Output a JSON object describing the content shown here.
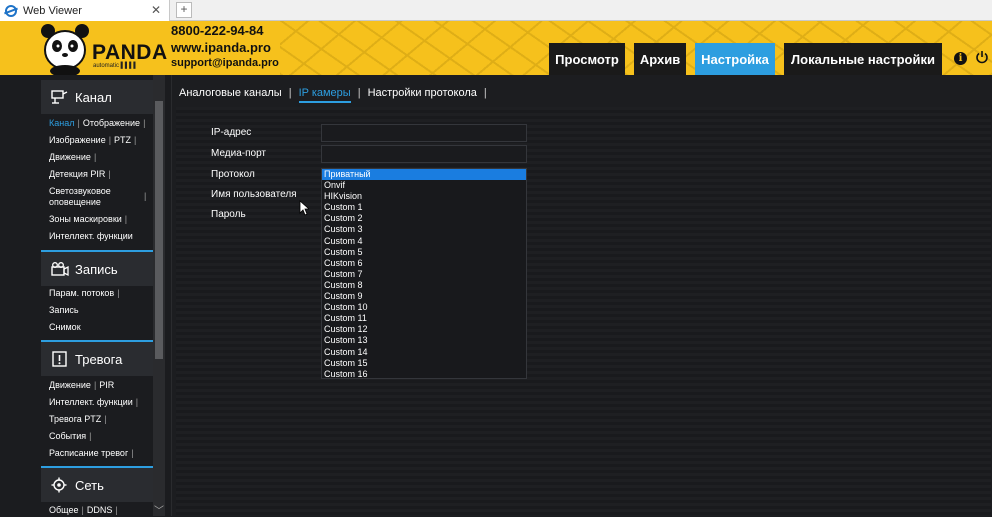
{
  "browser": {
    "tab_title": "Web Viewer",
    "close_glyph": "✕",
    "new_tab_glyph": "+"
  },
  "header": {
    "brand": "PANDA",
    "brand_sub": "automatic ▌▌▌▌",
    "phone": "8800-222-94-84",
    "website": "www.ipanda.pro",
    "email": "support@ipanda.pro",
    "nav": [
      {
        "label": "Просмотр",
        "active": false
      },
      {
        "label": "Архив",
        "active": false
      },
      {
        "label": "Настройка",
        "active": true
      },
      {
        "label": "Локальные настройки",
        "active": false
      }
    ],
    "info_glyph": "i"
  },
  "sidebar": {
    "sections": [
      {
        "title": "Канал",
        "icon": "camera-icon",
        "items": [
          "Канал",
          "Отображение",
          "Изображение",
          "PTZ",
          "Движение",
          "Детекция PIR",
          "Светозвуковое оповещение",
          "Зоны маскировки",
          "Интеллект. функции"
        ]
      },
      {
        "title": "Запись",
        "icon": "record-icon",
        "items": [
          "Парам. потоков",
          "Запись",
          "Снимок"
        ]
      },
      {
        "title": "Тревога",
        "icon": "alarm-icon",
        "items": [
          "Движение",
          "PIR",
          "Интеллект. функции",
          "Тревога PTZ",
          "События",
          "Расписание тревог"
        ]
      },
      {
        "title": "Сеть",
        "icon": "network-icon",
        "items": [
          "Общее",
          "DDNS"
        ]
      }
    ]
  },
  "main": {
    "tabs": [
      {
        "label": "Аналоговые каналы",
        "active": false
      },
      {
        "label": "IP камеры",
        "active": true
      },
      {
        "label": "Настройки протокола",
        "active": false
      }
    ],
    "fields": {
      "ip_label": "IP-адрес",
      "ip_value": "",
      "port_label": "Медиа-порт",
      "port_value": "",
      "protocol_label": "Протокол",
      "user_label": "Имя пользователя",
      "password_label": "Пароль"
    },
    "protocol_options": [
      "Приватный",
      "Onvif",
      "HIKvision",
      "Custom 1",
      "Custom 2",
      "Custom 3",
      "Custom 4",
      "Custom 5",
      "Custom 6",
      "Custom 7",
      "Custom 8",
      "Custom 9",
      "Custom 10",
      "Custom 11",
      "Custom 12",
      "Custom 13",
      "Custom 14",
      "Custom 15",
      "Custom 16"
    ],
    "protocol_selected": "Приватный"
  },
  "colors": {
    "accent": "#2d9ee0",
    "header_bg": "#f6c11c",
    "nav_bg": "#1a1a1a",
    "selection": "#1a7de0"
  }
}
